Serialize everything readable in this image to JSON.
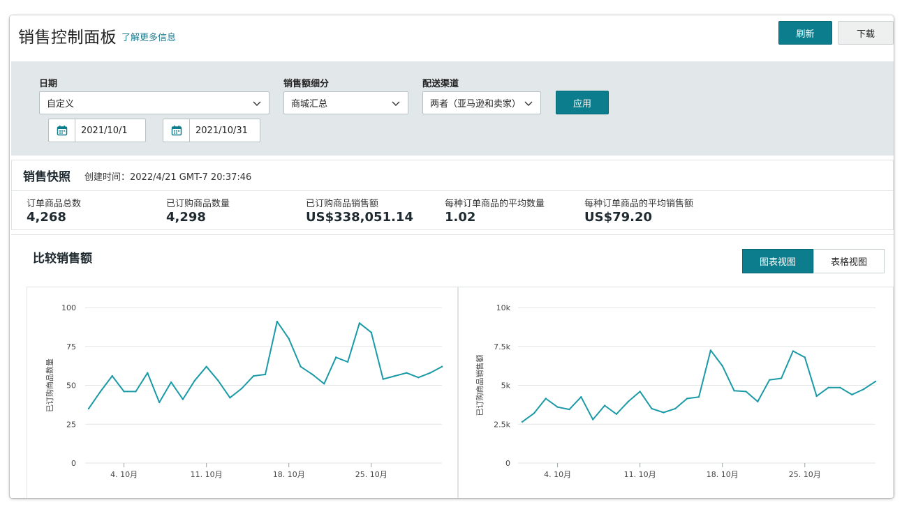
{
  "header": {
    "title": "销售控制面板",
    "learn_more": "了解更多信息",
    "refresh_label": "刷新",
    "download_label": "下载"
  },
  "filters": {
    "date_label": "日期",
    "date_value": "自定义",
    "start_date": "2021/10/1",
    "end_date": "2021/10/31",
    "breakdown_label": "销售额细分",
    "breakdown_value": "商城汇总",
    "channel_label": "配送渠道",
    "channel_value": "两者（亚马逊和卖家）",
    "apply_label": "应用"
  },
  "snapshot": {
    "title": "销售快照",
    "created": "创建时间：2022/4/21 GMT-7 20:37:46",
    "metrics": [
      {
        "label": "订单商品总数",
        "value": "4,268"
      },
      {
        "label": "已订购商品数量",
        "value": "4,298"
      },
      {
        "label": "已订购商品销售额",
        "value": "US$338,051.14"
      },
      {
        "label": "每种订单商品的平均数量",
        "value": "1.02"
      },
      {
        "label": "每种订单商品的平均销售额",
        "value": "US$79.20"
      }
    ]
  },
  "compare": {
    "title": "比较销售额",
    "chart_view_label": "图表视图",
    "table_view_label": "表格视图"
  },
  "colors": {
    "accent": "#0b7d8c",
    "line": "#1a9aa6",
    "filter_bg": "#e2e8ea"
  },
  "chart_data": [
    {
      "type": "line",
      "ylabel": "已订购商品数量",
      "ylim": [
        0,
        100
      ],
      "yticks": [
        "0",
        "25",
        "50",
        "75",
        "100"
      ],
      "yticks_values": [
        0,
        25,
        50,
        75,
        100
      ],
      "xlim": [
        1,
        31
      ],
      "xticks": [
        "4. 10月",
        "11. 10月",
        "18. 10月",
        "25. 10月"
      ],
      "xticks_values": [
        4,
        11,
        18,
        25
      ],
      "x": [
        1,
        2,
        3,
        4,
        5,
        6,
        7,
        8,
        9,
        10,
        11,
        12,
        13,
        14,
        15,
        16,
        17,
        18,
        19,
        20,
        21,
        22,
        23,
        24,
        25,
        26,
        27,
        28,
        29,
        30,
        31
      ],
      "series": [
        {
          "values": [
            35,
            46,
            56,
            46,
            46,
            58,
            39,
            52,
            41,
            53,
            62,
            53,
            42,
            48,
            56,
            57,
            91,
            80,
            62,
            57,
            51,
            68,
            65,
            90,
            84,
            54,
            56,
            58,
            55,
            58,
            62
          ]
        }
      ]
    },
    {
      "type": "line",
      "ylabel": "已订购商品销售额",
      "ylim": [
        0,
        10000
      ],
      "yticks": [
        "0",
        "2.5k",
        "5k",
        "7.5k",
        "10k"
      ],
      "yticks_values": [
        0,
        2500,
        5000,
        7500,
        10000
      ],
      "xlim": [
        1,
        31
      ],
      "xticks": [
        "4. 10月",
        "11. 10月",
        "18. 10月",
        "25. 10月"
      ],
      "xticks_values": [
        4,
        11,
        18,
        25
      ],
      "x": [
        1,
        2,
        3,
        4,
        5,
        6,
        7,
        8,
        9,
        10,
        11,
        12,
        13,
        14,
        15,
        16,
        17,
        18,
        19,
        20,
        21,
        22,
        23,
        24,
        25,
        26,
        27,
        28,
        29,
        30,
        31
      ],
      "series": [
        {
          "values": [
            2650,
            3200,
            4150,
            3600,
            3450,
            4250,
            2800,
            3700,
            3150,
            3950,
            4600,
            3500,
            3250,
            3500,
            4150,
            4250,
            7250,
            6250,
            4650,
            4600,
            3950,
            5350,
            5450,
            7200,
            6800,
            4300,
            4850,
            4850,
            4400,
            4750,
            5250
          ]
        }
      ]
    }
  ]
}
